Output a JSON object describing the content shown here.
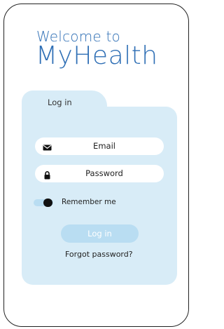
{
  "header": {
    "welcome": "Welcome to",
    "app_name": "MyHealth"
  },
  "login_card": {
    "tab_label": "Log in",
    "email": {
      "placeholder": "Email",
      "icon": "envelope-icon"
    },
    "password": {
      "placeholder": "Password",
      "icon": "lock-icon"
    },
    "remember_me": {
      "label": "Remember me",
      "on": true
    },
    "login_button": "Log in",
    "forgot_password": "Forgot password?"
  },
  "colors": {
    "brand": "#2f6fb5",
    "card_background": "#d8ecf7",
    "accent_light": "#b9ddf2"
  }
}
